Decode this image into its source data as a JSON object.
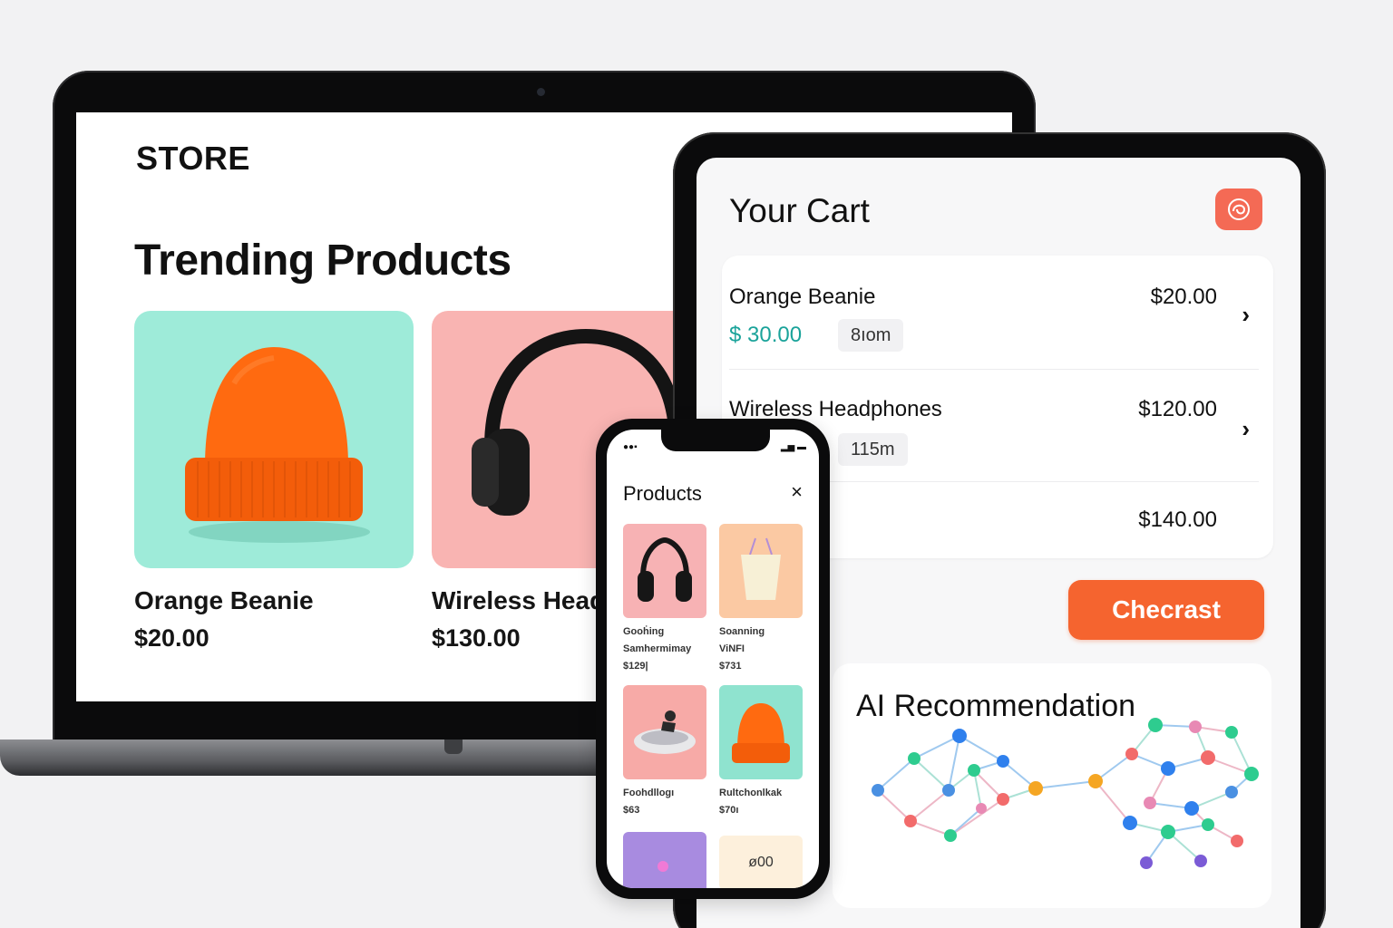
{
  "laptop": {
    "logo": "STORE",
    "heading": "Trending Products",
    "products": [
      {
        "name": "Orange Beanie",
        "price": "$20.00",
        "bg": "#9eebd9"
      },
      {
        "name": "Wireless Head",
        "price": "$130.00",
        "bg": "#f9b4b2"
      }
    ]
  },
  "cart": {
    "title": "Your Cart",
    "items": [
      {
        "name": "Orange Beanie",
        "price": "$20.00",
        "sub_price": "$ 30.00",
        "tag": "8ıom"
      },
      {
        "name": "Wireless Headphones",
        "price": "$120.00",
        "tag": "115m"
      }
    ],
    "total": "$140.00",
    "checkout_label": "Checrast",
    "badge_icon": "swirl-icon",
    "accent": "#f5642f",
    "badge_color": "#f46a55",
    "sub_price_color": "#1aa39a"
  },
  "ai": {
    "title": "AI Recommendation"
  },
  "phone": {
    "title": "Products",
    "close_icon": "close-icon",
    "items": [
      {
        "line1": "Gooḣing",
        "line2": "Samhermimay",
        "line3": "$129|",
        "bg": "#f7b2b4",
        "icon": "headphones-icon"
      },
      {
        "line1": "Soanning",
        "line2": "ViNFI",
        "line3": "$731",
        "bg": "#fbc9a3",
        "icon": "tote-bag-icon"
      },
      {
        "line1": "Foohdllogı",
        "line2": "$63",
        "line3": "",
        "bg": "#f7aaa7",
        "icon": "shoe-icon"
      },
      {
        "line1": "Rultchonlkak",
        "line2": "$70ı",
        "line3": "",
        "bg": "#8fe3cf",
        "icon": "beanie-icon"
      },
      {
        "line1": "",
        "line2": "",
        "line3": "",
        "bg": "#a88be0",
        "icon": "dot-icon"
      },
      {
        "line1": "ø00",
        "line2": "",
        "line3": "",
        "bg": "#fdf0dc",
        "icon": ""
      }
    ]
  }
}
